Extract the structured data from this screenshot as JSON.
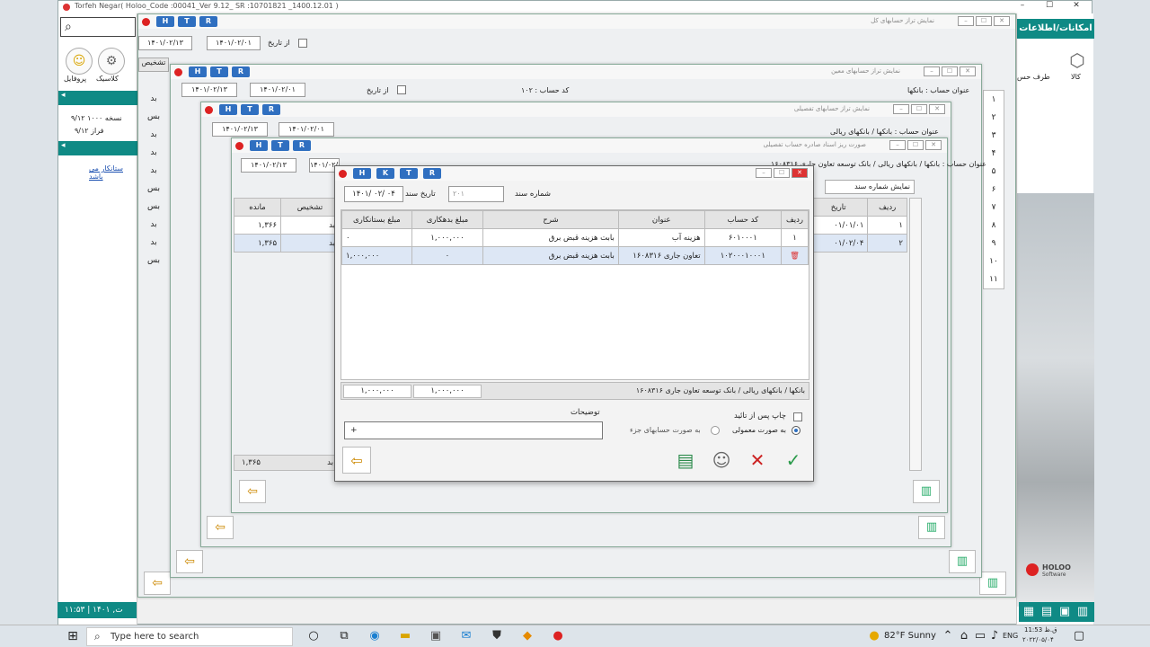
{
  "app": {
    "title": "Torfeh Negar( Holoo_Code :00041_Ver 9.12_ SR :10701821 _1400.12.01 )",
    "minimize": "–",
    "maximize": "☐",
    "close": "✕"
  },
  "left_panel": {
    "profile_label": "پروفایل",
    "classic_label": "کلاسیک",
    "line1": "۹/۱۲ نسخه ۱۰۰۰",
    "line2": "۹/۱۲ فراز",
    "link": "ستانکار می باشد"
  },
  "right_panel": {
    "features_label": "امکانات/اطلاعات",
    "goods_label": "کالا",
    "party_label": "طرف حس",
    "brand": "HOLOO",
    "brand_sub": "Software"
  },
  "hk_buttons": [
    "H",
    "T",
    "R"
  ],
  "dialog_hk_buttons": [
    "H",
    "K",
    "T",
    "R"
  ],
  "win1": {
    "title": "نمایش تراز حسابهای کل",
    "date_to": "۱۴۰۱/۰۲/۱۳",
    "date_from": "۱۴۰۱/۰۲/۰۱",
    "from_label": "از تاریخ"
  },
  "win2": {
    "title": "نمایش تراز حسابهای معین",
    "date_to": "۱۴۰۱/۰۲/۱۳",
    "date_from": "۱۴۰۱/۰۲/۰۱",
    "from_label": "از تاریخ",
    "account_code": "کد حساب : ۱۰۲",
    "account_title": "عنوان حساب : بانکها"
  },
  "win3": {
    "title": "نمایش تراز حسابهای تفصیلی",
    "date_to": "۱۴۰۱/۰۲/۱۳",
    "date_from": "۱۴۰۱/۰۲/۰۱",
    "from_label": "از تاریخ",
    "account_title": "عنوان حساب : بانکها / بانکهای ریالی"
  },
  "win4": {
    "title": "صورت ریز اسناد صادره حساب تفصیلی",
    "date_to": "۱۴۰۱/۰۲/۱۳",
    "date_from": "۱۴۰۱/۰۲/۰۱",
    "account_title": "عنوان حساب : بانکها / بانکهای ریالی / بانک توسعه تعاون جاری ۱۶۰۸۳۱۶",
    "show_doc_label": "نمایش شماره سند",
    "columns": [
      "ردیف",
      "تاریخ",
      "مانده",
      "تشخیص"
    ],
    "rows": [
      {
        "idx": "۱",
        "date": "۰۱/۰۱/۰۱",
        "balance": "۱,۳۶۶",
        "type": "بد"
      },
      {
        "idx": "۲",
        "date": "۰۱/۰۲/۰۴",
        "balance": "۱,۳۶۵",
        "type": "بد"
      }
    ],
    "footer_balance": "۱,۳۶۵",
    "footer_type": "بد"
  },
  "bg_rows": [
    "بد",
    "بس",
    "بد",
    "بد",
    "بد",
    "بس",
    "بس",
    "بد",
    "بد",
    "بس"
  ],
  "bg_header": "تشخیص",
  "right_index": [
    "۱",
    "۲",
    "۳",
    "۴",
    "۵",
    "۶",
    "۷",
    "۸",
    "۹",
    "۱۰",
    "۱۱"
  ],
  "dialog": {
    "doc_number_label": "شماره سند",
    "doc_number_value": "۲۰۱",
    "doc_date_label": "تاریخ سند",
    "doc_date_value": "۱۴۰۱/ ۰۲/ ۰۴",
    "columns": [
      "ردیف",
      "کد حساب",
      "عنوان",
      "شرح",
      "مبلغ بدهکاری",
      "مبلغ بستانکاری"
    ],
    "rows": [
      {
        "idx": "۱",
        "code": "۶۰۱۰۰۰۱",
        "title": "هزینه آب",
        "desc": "بابت هزینه قبض برق",
        "debit": "۱,۰۰۰,۰۰۰",
        "credit": "۰"
      },
      {
        "idx": "",
        "code": "۱۰۲۰۰۰۱۰۰۰۱",
        "title": "تعاون جاری ۱۶۰۸۳۱۶",
        "desc": "بابت هزینه قبض برق",
        "debit": "۰",
        "credit": "۱,۰۰۰,۰۰۰"
      }
    ],
    "footer_path": "بانکها / بانکهای ریالی / بانک توسعه تعاون جاری ۱۶۰۸۳۱۶",
    "footer_debit": "۱,۰۰۰,۰۰۰",
    "footer_credit": "۱,۰۰۰,۰۰۰",
    "print_after_confirm": "چاپ پس از تائید",
    "radio_normal": "به صورت معمولی",
    "radio_detail": "به صورت حسابهای جزء",
    "notes_label": "توضیحات",
    "notes_value": "+"
  },
  "taskbar": {
    "search_placeholder": "Type here to search",
    "weather": "82°F  Sunny",
    "lang": "ENG",
    "time": "11:53 ق.ظ",
    "date": "۲۰۲۲/۰۵/۰۴"
  },
  "status": {
    "clock": "۱۱:۵۳ | ۱۴۰۱ ,ت"
  }
}
